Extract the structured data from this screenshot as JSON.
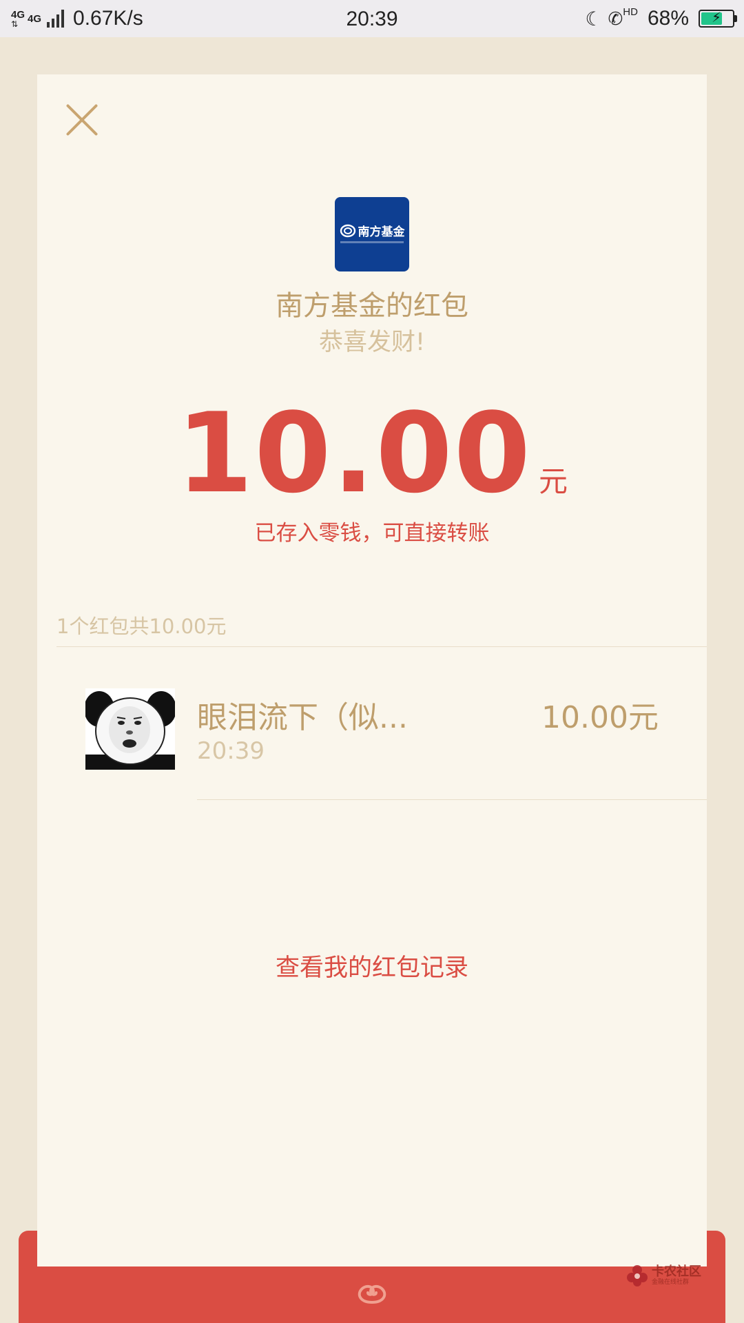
{
  "status_bar": {
    "network_1": "4G",
    "network_2": "4G",
    "speed": "0.67K/s",
    "time": "20:39",
    "hd_label": "HD",
    "battery_percent": "68%",
    "battery_level": 0.68,
    "icons": [
      "signal-icon",
      "moon-icon",
      "phone-icon",
      "battery-icon"
    ]
  },
  "card": {
    "close_icon": "close-icon",
    "logo": {
      "text": "南方基金"
    },
    "sender_title": "南方基金的红包",
    "wish": "恭喜发财!",
    "amount": "10.00",
    "unit": "元",
    "deposit_note": "已存入零钱，可直接转账",
    "summary": "1个红包共10.00元",
    "receivers": [
      {
        "name": "眼泪流下（似...",
        "time": "20:39",
        "amount": "10.00元"
      }
    ],
    "records_link": "查看我的红包记录"
  },
  "watermark": {
    "title": "卡农社区",
    "subtitle": "金融在线社群"
  },
  "colors": {
    "accent_red": "#DA4D43",
    "gold": "#BE9E6C",
    "card_bg": "#FAF6EC",
    "page_bg": "#EEE6D6",
    "logo_blue": "#0E3F92"
  }
}
